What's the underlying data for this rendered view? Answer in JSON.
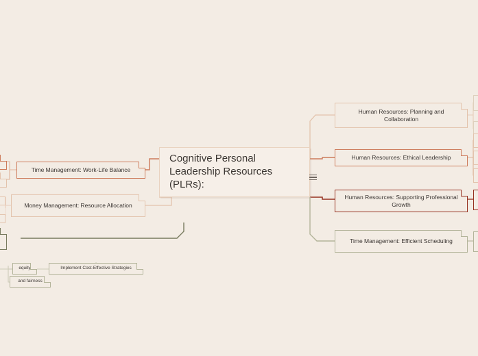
{
  "app": {
    "background_color": "#f3ece4",
    "type": "mind-map"
  },
  "root": {
    "label": "Cognitive Personal Leadership Resources (PLRs):",
    "collapse_icon": "hamburger-collapse-icon"
  },
  "branches": {
    "right": [
      {
        "id": "hr-planning",
        "label": "Human Resources: Planning and Collaboration",
        "color": "#e3c3ac",
        "children_offscreen": 2
      },
      {
        "id": "hr-ethical",
        "label": "Human Resources: Ethical Leadership",
        "color": "#cd7b5b",
        "children_offscreen": 3
      },
      {
        "id": "hr-growth",
        "label": "Human Resources: Supporting Professional Growth",
        "color": "#96301f",
        "children_offscreen": 1
      },
      {
        "id": "tm-scheduling",
        "label": "Time Management: Efficient Scheduling",
        "color": "#b3b49a",
        "children_offscreen": 1
      }
    ],
    "left": [
      {
        "id": "tm-worklife",
        "label": "Time Management: Work-Life Balance",
        "color": "#cd7b5b",
        "children_offscreen": 2
      },
      {
        "id": "mm-resource",
        "label": "Money Management: Resource Allocation",
        "color": "#e3c3ac",
        "children_offscreen": 2
      }
    ]
  },
  "lower_left_cluster": {
    "nodes": [
      {
        "id": "equity",
        "label": "equity",
        "color": "#b3b49a"
      },
      {
        "id": "fairness",
        "label": "and fairness",
        "color": "#b3b49a"
      },
      {
        "id": "cost-effective",
        "label": "Implement Cost-Effective Strategies",
        "color": "#b3b49a"
      }
    ]
  }
}
